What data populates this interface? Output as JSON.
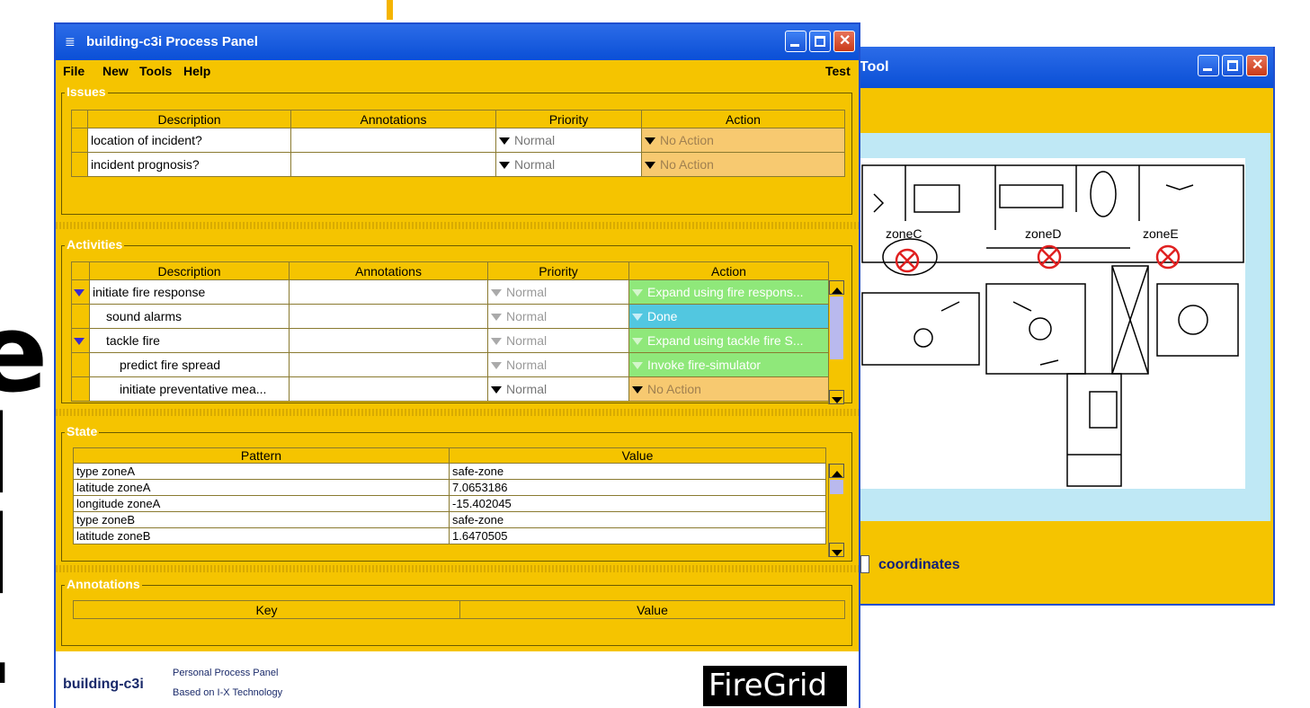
{
  "back_window": {
    "title": "Tool",
    "zones": [
      "zoneC",
      "zoneD",
      "zoneE"
    ],
    "coordinates_label": "coordinates"
  },
  "window": {
    "title": "building-c3i Process Panel"
  },
  "menu": {
    "file": "File",
    "new": "New",
    "tools": "Tools",
    "help": "Help",
    "test": "Test"
  },
  "issues": {
    "legend": "Issues",
    "headers": [
      "Description",
      "Annotations",
      "Priority",
      "Action"
    ],
    "rows": [
      {
        "description": "location of incident?",
        "priority": "Normal",
        "action": "No Action"
      },
      {
        "description": "incident prognosis?",
        "priority": "Normal",
        "action": "No Action"
      }
    ]
  },
  "activities": {
    "legend": "Activities",
    "headers": [
      "Description",
      "Annotations",
      "Priority",
      "Action"
    ],
    "rows": [
      {
        "description": "initiate fire response",
        "priority": "Normal",
        "action": "Expand using fire respons..."
      },
      {
        "description": "sound alarms",
        "priority": "Normal",
        "action": "Done"
      },
      {
        "description": "tackle fire",
        "priority": "Normal",
        "action": "Expand using tackle fire S..."
      },
      {
        "description": "predict fire spread",
        "priority": "Normal",
        "action": "Invoke fire-simulator"
      },
      {
        "description": "initiate preventative mea...",
        "priority": "Normal",
        "action": "No Action"
      }
    ]
  },
  "state": {
    "legend": "State",
    "headers": [
      "Pattern",
      "Value"
    ],
    "rows": [
      {
        "pattern": "type zoneA",
        "value": "safe-zone"
      },
      {
        "pattern": "latitude zoneA",
        "value": "7.0653186"
      },
      {
        "pattern": "longitude zoneA",
        "value": "-15.402045"
      },
      {
        "pattern": "type zoneB",
        "value": "safe-zone"
      },
      {
        "pattern": "latitude zoneB",
        "value": "1.6470505"
      }
    ]
  },
  "annotations": {
    "legend": "Annotations",
    "headers": [
      "Key",
      "Value"
    ]
  },
  "footer": {
    "app": "building-c3i",
    "line1": "Personal Process Panel",
    "line2": "Based on I-X Technology",
    "logo": "FireGrid"
  }
}
